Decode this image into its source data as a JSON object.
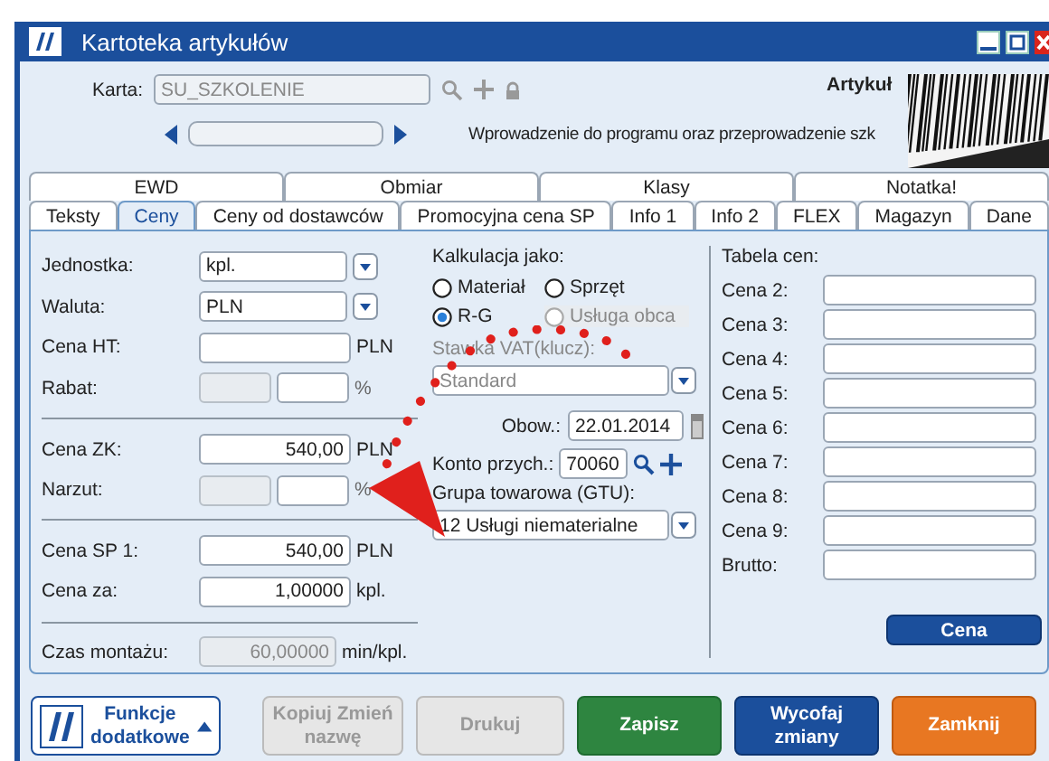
{
  "window": {
    "title": "Kartoteka artykułów"
  },
  "header": {
    "card_label": "Karta:",
    "card_value": "SU_SZKOLENIE",
    "type_label": "Artykuł",
    "description": "Wprowadzenie do programu oraz przeprowadzenie szk"
  },
  "tabs_top": [
    {
      "label": "EWD",
      "selected": false
    },
    {
      "label": "Obmiar",
      "selected": false
    },
    {
      "label": "Klasy",
      "selected": false
    },
    {
      "label": "Notatka!",
      "selected": false
    }
  ],
  "tabs": [
    {
      "label": "Teksty",
      "selected": false
    },
    {
      "label": "Ceny",
      "selected": true
    },
    {
      "label": "Ceny od dostawców",
      "selected": false
    },
    {
      "label": "Promocyjna cena SP",
      "selected": false
    },
    {
      "label": "Info 1",
      "selected": false
    },
    {
      "label": "Info 2",
      "selected": false
    },
    {
      "label": "FLEX",
      "selected": false
    },
    {
      "label": "Magazyn",
      "selected": false
    },
    {
      "label": "Dane",
      "selected": false
    }
  ],
  "left_groups": [
    [
      {
        "kind": "select",
        "label": "Jednostka:",
        "value": "kpl."
      },
      {
        "kind": "select",
        "label": "Waluta:",
        "value": "PLN"
      },
      {
        "kind": "input",
        "label": "Cena HT:",
        "unit": "PLN"
      },
      {
        "kind": "split",
        "label": "Rabat:",
        "unit": "%",
        "fields": [
          {
            "disabled": true
          },
          {
            "disabled": false
          }
        ]
      }
    ],
    [
      {
        "kind": "input",
        "label": "Cena ZK:",
        "value": "540,00",
        "unit": "PLN"
      },
      {
        "kind": "split",
        "label": "Narzut:",
        "unit": "%",
        "fields": [
          {
            "disabled": true
          },
          {
            "disabled": false
          }
        ]
      }
    ],
    [
      {
        "kind": "input",
        "label": "Cena SP 1:",
        "value": "540,00",
        "unit": "PLN"
      },
      {
        "kind": "input",
        "label": "Cena za:",
        "value": "1,00000",
        "unit": "kpl."
      }
    ],
    [
      {
        "kind": "disabled",
        "label": "Czas montażu:",
        "value": "60,00000",
        "unit": "min/kpl."
      }
    ]
  ],
  "calculation": {
    "label": "Kalkulacja jako:",
    "options": [
      {
        "label": "Materiał",
        "selected": false,
        "disabled": false
      },
      {
        "label": "Sprzęt",
        "selected": false,
        "disabled": false
      },
      {
        "label": "R-G",
        "selected": true,
        "disabled": false
      },
      {
        "label": "Usługa obca",
        "selected": false,
        "disabled": true
      }
    ]
  },
  "vat": {
    "label": "Stawka VAT(klucz):",
    "value": "Standard",
    "disabled": true
  },
  "valid_from": {
    "label": "Obow.:",
    "value": "22.01.2014"
  },
  "income_account": {
    "label": "Konto przych.:",
    "value": "70060"
  },
  "gtu": {
    "label": "Grupa towarowa (GTU):",
    "value": "12 Usługi niematerialne"
  },
  "price_table": {
    "label": "Tabela cen:",
    "rows": [
      "Cena 2:",
      "Cena 3:",
      "Cena 4:",
      "Cena 5:",
      "Cena 6:",
      "Cena 7:",
      "Cena 8:",
      "Cena 9:",
      "Brutto:"
    ],
    "button": "Cena"
  },
  "buttons": [
    {
      "kind": "functions",
      "label": "Funkcje dodatkowe"
    },
    {
      "kind": "disabled",
      "label": "Kopiuj Zmień nazwę"
    },
    {
      "kind": "disabled",
      "label": "Drukuj"
    },
    {
      "kind": "save",
      "label": "Zapisz"
    },
    {
      "kind": "undo",
      "label": "Wycofaj zmiany"
    },
    {
      "kind": "close",
      "label": "Zamknij"
    }
  ]
}
